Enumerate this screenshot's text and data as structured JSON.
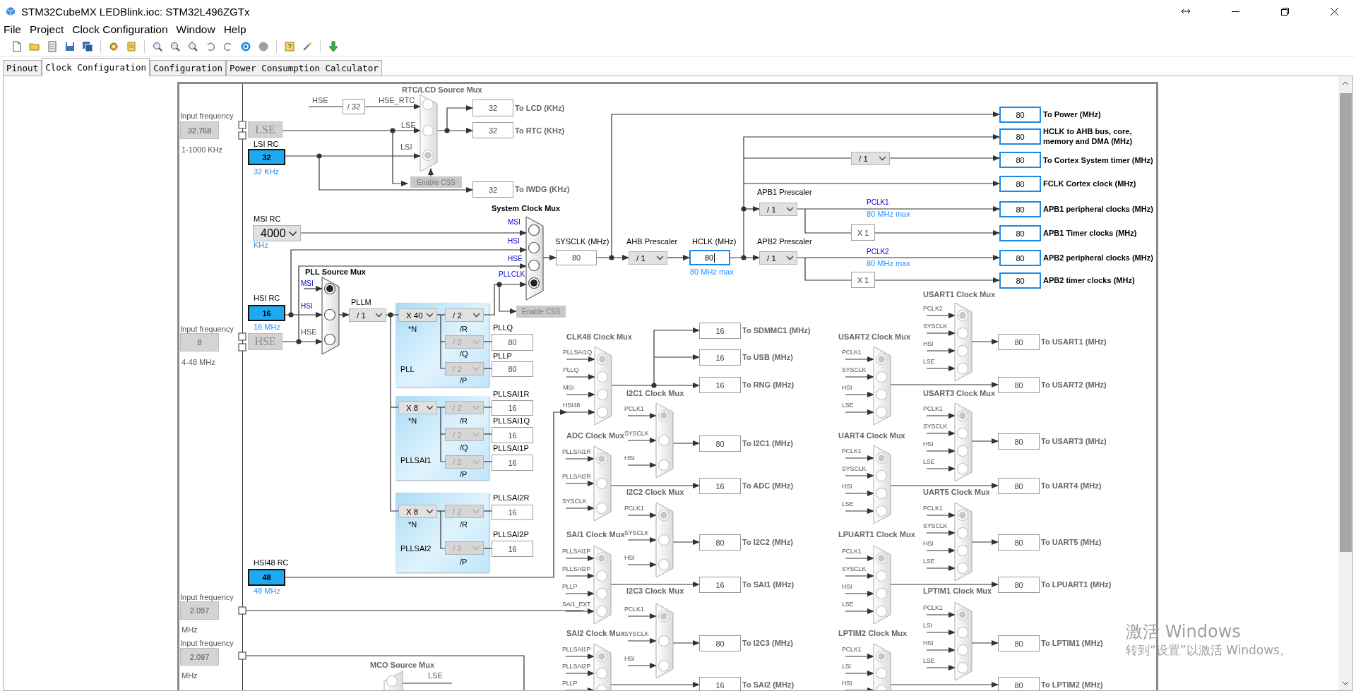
{
  "window": {
    "title": "STM32CubeMX LEDBlink.ioc: STM32L496ZGTx"
  },
  "menu": [
    "File",
    "Project",
    "Clock Configuration",
    "Window",
    "Help"
  ],
  "tabs": [
    {
      "label": "Pinout",
      "selected": false
    },
    {
      "label": "Clock Configuration",
      "selected": true
    },
    {
      "label": "Configuration",
      "selected": false
    },
    {
      "label": "Power Consumption Calculator",
      "selected": false
    }
  ],
  "diagram": {
    "texts": [
      {
        "text": "RTC/LCD Source Mux",
        "kind": "title"
      },
      {
        "text": "HSE",
        "kind": "dim"
      },
      {
        "text": "HSE_RTC",
        "kind": "dim"
      },
      {
        "text": "LSE",
        "kind": "dim"
      },
      {
        "text": "LSI",
        "kind": "dim"
      },
      {
        "text": "To LCD (KHz)",
        "kind": "outDim"
      },
      {
        "text": "To RTC (KHz)",
        "kind": "outDim"
      },
      {
        "text": "To IWDG (KHz)",
        "kind": "outDim"
      },
      {
        "text": "Input frequency",
        "kind": "dim"
      },
      {
        "text": "1-1000 KHz",
        "kind": "dim"
      },
      {
        "text": "LSI RC",
        "kind": "plain"
      },
      {
        "text": "32 KHz",
        "kind": "blue"
      },
      {
        "text": "System Clock Mux",
        "kind": "titleDark"
      },
      {
        "text": "MSI RC",
        "kind": "plain"
      },
      {
        "text": "KHz",
        "kind": "blue"
      },
      {
        "text": "MSI",
        "kind": "navy"
      },
      {
        "text": "HSI",
        "kind": "navy"
      },
      {
        "text": "HSE",
        "kind": "navy"
      },
      {
        "text": "PLLCLK",
        "kind": "navy"
      },
      {
        "text": "SYSCLK (MHz)",
        "kind": "plain"
      },
      {
        "text": "AHB Prescaler",
        "kind": "plain"
      },
      {
        "text": "HCLK (MHz)",
        "kind": "plain"
      },
      {
        "text": "80 MHz max",
        "kind": "blue"
      },
      {
        "text": "APB1 Prescaler",
        "kind": "plain"
      },
      {
        "text": "PCLK1",
        "kind": "navy"
      },
      {
        "text": "80 MHz max",
        "kind": "blue"
      },
      {
        "text": "APB2 Prescaler",
        "kind": "plain"
      },
      {
        "text": "PCLK2",
        "kind": "navy"
      },
      {
        "text": "80 MHz max",
        "kind": "blue"
      },
      {
        "text": "To Power (MHz)",
        "kind": "out"
      },
      {
        "text": "HCLK to AHB bus, core,\nmemory and DMA (MHz)",
        "kind": "out"
      },
      {
        "text": "To Cortex System timer (MHz)",
        "kind": "out"
      },
      {
        "text": "FCLK Cortex clock (MHz)",
        "kind": "out"
      },
      {
        "text": "APB1 peripheral clocks (MHz)",
        "kind": "out"
      },
      {
        "text": "APB1 Timer clocks (MHz)",
        "kind": "out"
      },
      {
        "text": "APB2 peripheral clocks (MHz)",
        "kind": "out"
      },
      {
        "text": "APB2 timer clocks (MHz)",
        "kind": "out"
      },
      {
        "text": "PLL Source Mux",
        "kind": "titleDark"
      },
      {
        "text": "MSI",
        "kind": "navy"
      },
      {
        "text": "HSI",
        "kind": "navy"
      },
      {
        "text": "HSE",
        "kind": "dim"
      },
      {
        "text": "HSI RC",
        "kind": "plain"
      },
      {
        "text": "16 MHz",
        "kind": "blue"
      },
      {
        "text": "Input frequency",
        "kind": "dim"
      },
      {
        "text": "4-48 MHz",
        "kind": "dim"
      },
      {
        "text": "PLLM",
        "kind": "plain"
      },
      {
        "text": "*N",
        "kind": "plain"
      },
      {
        "text": "/R",
        "kind": "plain"
      },
      {
        "text": "/Q",
        "kind": "plain"
      },
      {
        "text": "/P",
        "kind": "plain"
      },
      {
        "text": "PLL",
        "kind": "plain"
      },
      {
        "text": "PLLQ",
        "kind": "plain"
      },
      {
        "text": "PLLP",
        "kind": "plain"
      },
      {
        "text": "*N",
        "kind": "plain"
      },
      {
        "text": "/R",
        "kind": "plain"
      },
      {
        "text": "/Q",
        "kind": "plain"
      },
      {
        "text": "/P",
        "kind": "plain"
      },
      {
        "text": "PLLSAI1",
        "kind": "plain"
      },
      {
        "text": "PLLSAI1R",
        "kind": "plain"
      },
      {
        "text": "PLLSAI1Q",
        "kind": "plain"
      },
      {
        "text": "PLLSAI1P",
        "kind": "plain"
      },
      {
        "text": "*N",
        "kind": "plain"
      },
      {
        "text": "/R",
        "kind": "plain"
      },
      {
        "text": "/P",
        "kind": "plain"
      },
      {
        "text": "PLLSAI2",
        "kind": "plain"
      },
      {
        "text": "PLLSAI2R",
        "kind": "plain"
      },
      {
        "text": "PLLSAI2P",
        "kind": "plain"
      },
      {
        "text": "HSI48 RC",
        "kind": "plain"
      },
      {
        "text": "48 MHz",
        "kind": "blue"
      },
      {
        "text": "Input frequency",
        "kind": "dim"
      },
      {
        "text": "MHz",
        "kind": "dim"
      },
      {
        "text": "Input frequency",
        "kind": "dim"
      },
      {
        "text": "MHz",
        "kind": "dim"
      },
      {
        "text": "MCO Source Mux",
        "kind": "title"
      },
      {
        "text": "LSE",
        "kind": "dim"
      }
    ],
    "oscillators": [
      {
        "label": "LSE"
      },
      {
        "label": "HSE"
      }
    ],
    "fields": [
      {
        "value": "32.768",
        "kind": "input"
      },
      {
        "value": "32",
        "kind": "source"
      },
      {
        "value": "/ 32",
        "kind": "plain"
      },
      {
        "value": "32",
        "kind": "plain"
      },
      {
        "value": "32",
        "kind": "plain"
      },
      {
        "value": "32",
        "kind": "plain"
      },
      {
        "value": "16",
        "kind": "source"
      },
      {
        "value": "8",
        "kind": "input"
      },
      {
        "value": "80",
        "kind": "plain"
      },
      {
        "value": "80",
        "kind": "focus"
      },
      {
        "value": "X 1",
        "kind": "plain"
      },
      {
        "value": "X 1",
        "kind": "plain"
      },
      {
        "value": "80",
        "kind": "output"
      },
      {
        "value": "80",
        "kind": "output"
      },
      {
        "value": "80",
        "kind": "output"
      },
      {
        "value": "80",
        "kind": "output"
      },
      {
        "value": "80",
        "kind": "output"
      },
      {
        "value": "80",
        "kind": "output"
      },
      {
        "value": "80",
        "kind": "output"
      },
      {
        "value": "80",
        "kind": "output"
      },
      {
        "value": "80",
        "kind": "plain"
      },
      {
        "value": "80",
        "kind": "plain"
      },
      {
        "value": "16",
        "kind": "plain"
      },
      {
        "value": "16",
        "kind": "plain"
      },
      {
        "value": "16",
        "kind": "plain"
      },
      {
        "value": "16",
        "kind": "plain"
      },
      {
        "value": "16",
        "kind": "plain"
      },
      {
        "value": "48",
        "kind": "source"
      },
      {
        "value": "2.097",
        "kind": "input"
      },
      {
        "value": "2.097",
        "kind": "input"
      }
    ],
    "dropdowns": [
      {
        "value": "4000",
        "disabled": false
      },
      {
        "value": "/ 1",
        "disabled": false
      },
      {
        "value": "X 40",
        "disabled": false
      },
      {
        "value": "/ 2",
        "disabled": false
      },
      {
        "value": "/ 2",
        "disabled": true
      },
      {
        "value": "/ 2",
        "disabled": true
      },
      {
        "value": "X 8",
        "disabled": false
      },
      {
        "value": "/ 2",
        "disabled": true
      },
      {
        "value": "/ 2",
        "disabled": true
      },
      {
        "value": "/ 2",
        "disabled": true
      },
      {
        "value": "X 8",
        "disabled": false
      },
      {
        "value": "/ 2",
        "disabled": true
      },
      {
        "value": "/ 2",
        "disabled": true
      },
      {
        "value": "/ 1",
        "disabled": false
      },
      {
        "value": "/ 1",
        "disabled": false
      },
      {
        "value": "/ 1",
        "disabled": false
      },
      {
        "value": "/ 1",
        "disabled": false
      }
    ],
    "buttons": [
      {
        "label": "Enable CSS",
        "disabled": true
      },
      {
        "label": "Enable CSS",
        "disabled": true
      }
    ],
    "selectors": [
      {
        "disabled": true,
        "inputs": [
          {
            "selected": false
          },
          {
            "selected": false
          },
          {
            "selected": true
          }
        ]
      },
      {
        "disabled": false,
        "inputs": [
          {
            "selected": false
          },
          {
            "selected": false
          },
          {
            "selected": false
          },
          {
            "selected": true
          }
        ]
      },
      {
        "disabled": false,
        "inputs": [
          {
            "selected": true
          },
          {
            "selected": false
          },
          {
            "selected": false
          }
        ]
      },
      {
        "disabled": true,
        "inputs": [
          {
            "selected": false
          }
        ]
      }
    ],
    "peripheral_muxes": [
      {
        "title": "USART1 Clock Mux",
        "inputs": [
          {
            "label": "PCLK2",
            "selected": true
          },
          {
            "label": "SYSCLK",
            "selected": false
          },
          {
            "label": "HSI",
            "selected": false
          },
          {
            "label": "LSE",
            "selected": false
          }
        ],
        "outputs": [
          {
            "value": "80",
            "label": "To USART1 (MHz)"
          }
        ]
      },
      {
        "title": "CLK48 Clock Mux",
        "inputs": [
          {
            "label": "PLLSAI1Q",
            "selected": true
          },
          {
            "label": "PLLQ",
            "selected": false
          },
          {
            "label": "MSI",
            "selected": false
          },
          {
            "label": "HSI48",
            "selected": false
          }
        ],
        "outputs": [
          {
            "value": "16",
            "label": "To SDMMC1 (MHz)"
          },
          {
            "value": "16",
            "label": "To USB (MHz)"
          },
          {
            "value": "16",
            "label": "To RNG (MHz)"
          }
        ]
      },
      {
        "title": "USART2 Clock Mux",
        "inputs": [
          {
            "label": "PCLK1",
            "selected": true
          },
          {
            "label": "SYSCLK",
            "selected": false
          },
          {
            "label": "HSI",
            "selected": false
          },
          {
            "label": "LSE",
            "selected": false
          }
        ],
        "outputs": [
          {
            "value": "80",
            "label": "To USART2 (MHz)"
          }
        ]
      },
      {
        "title": "I2C1 Clock Mux",
        "inputs": [
          {
            "label": "PCLK1",
            "selected": true
          },
          {
            "label": "SYSCLK",
            "selected": false
          },
          {
            "label": "HSI",
            "selected": false
          }
        ],
        "outputs": [
          {
            "value": "80",
            "label": "To I2C1 (MHz)"
          }
        ]
      },
      {
        "title": "USART3 Clock Mux",
        "inputs": [
          {
            "label": "PCLK1",
            "selected": true
          },
          {
            "label": "SYSCLK",
            "selected": false
          },
          {
            "label": "HSI",
            "selected": false
          },
          {
            "label": "LSE",
            "selected": false
          }
        ],
        "outputs": [
          {
            "value": "80",
            "label": "To USART3 (MHz)"
          }
        ]
      },
      {
        "title": "ADC Clock Mux",
        "inputs": [
          {
            "label": "PLLSAI1R",
            "selected": true
          },
          {
            "label": "PLLSAI2R",
            "selected": false
          },
          {
            "label": "SYSCLK",
            "selected": false
          }
        ],
        "outputs": [
          {
            "value": "16",
            "label": "To ADC (MHz)"
          }
        ]
      },
      {
        "title": "UART4 Clock Mux",
        "inputs": [
          {
            "label": "PCLK1",
            "selected": true
          },
          {
            "label": "SYSCLK",
            "selected": false
          },
          {
            "label": "HSI",
            "selected": false
          },
          {
            "label": "LSE",
            "selected": false
          }
        ],
        "outputs": [
          {
            "value": "80",
            "label": "To UART4 (MHz)"
          }
        ]
      },
      {
        "title": "I2C2 Clock Mux",
        "inputs": [
          {
            "label": "PCLK1",
            "selected": true
          },
          {
            "label": "SYSCLK",
            "selected": false
          },
          {
            "label": "HSI",
            "selected": false
          }
        ],
        "outputs": [
          {
            "value": "80",
            "label": "To I2C2 (MHz)"
          }
        ]
      },
      {
        "title": "UART5 Clock Mux",
        "inputs": [
          {
            "label": "PCLK1",
            "selected": true
          },
          {
            "label": "SYSCLK",
            "selected": false
          },
          {
            "label": "HSI",
            "selected": false
          },
          {
            "label": "LSE",
            "selected": false
          }
        ],
        "outputs": [
          {
            "value": "80",
            "label": "To UART5 (MHz)"
          }
        ]
      },
      {
        "title": "SAI1 Clock Mux",
        "inputs": [
          {
            "label": "PLLSAI1P",
            "selected": true
          },
          {
            "label": "PLLSAI2P",
            "selected": false
          },
          {
            "label": "PLLP",
            "selected": false
          },
          {
            "label": "SAI1_EXT",
            "selected": false
          }
        ],
        "outputs": [
          {
            "value": "16",
            "label": "To SAI1 (MHz)"
          }
        ]
      },
      {
        "title": "LPUART1 Clock Mux",
        "inputs": [
          {
            "label": "PCLK1",
            "selected": true
          },
          {
            "label": "SYSCLK",
            "selected": false
          },
          {
            "label": "HSI",
            "selected": false
          },
          {
            "label": "LSE",
            "selected": false
          }
        ],
        "outputs": [
          {
            "value": "80",
            "label": "To LPUART1 (MHz)"
          }
        ]
      },
      {
        "title": "I2C3 Clock Mux",
        "inputs": [
          {
            "label": "PCLK1",
            "selected": true
          },
          {
            "label": "SYSCLK",
            "selected": false
          },
          {
            "label": "HSI",
            "selected": false
          }
        ],
        "outputs": [
          {
            "value": "80",
            "label": "To I2C3 (MHz)"
          }
        ]
      },
      {
        "title": "LPTIM1 Clock Mux",
        "inputs": [
          {
            "label": "PCLK1",
            "selected": true
          },
          {
            "label": "LSI",
            "selected": false
          },
          {
            "label": "HSI",
            "selected": false
          },
          {
            "label": "LSE",
            "selected": false
          }
        ],
        "outputs": [
          {
            "value": "80",
            "label": "To LPTIM1 (MHz)"
          }
        ]
      },
      {
        "title": "SAI2 Clock Mux",
        "inputs": [
          {
            "label": "PLLSAI1P",
            "selected": true
          },
          {
            "label": "PLLSAI2P",
            "selected": false
          },
          {
            "label": "PLLP",
            "selected": false
          }
        ],
        "outputs": [
          {
            "value": "16",
            "label": "To SAI2 (MHz)"
          }
        ]
      },
      {
        "title": "LPTIM2 Clock Mux",
        "inputs": [
          {
            "label": "PCLK1",
            "selected": true
          },
          {
            "label": "LSI",
            "selected": false
          },
          {
            "label": "HSI",
            "selected": false
          }
        ],
        "outputs": [
          {
            "value": "80",
            "label": "To LPTIM2 (MHz)"
          }
        ]
      }
    ]
  },
  "activation_notice": {
    "title": "激活 Windows",
    "hint": "转到“设置”以激活 Windows。"
  }
}
